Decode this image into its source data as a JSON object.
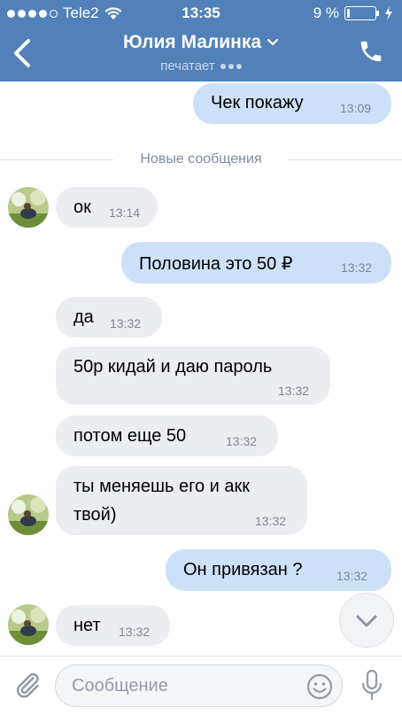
{
  "status_bar": {
    "carrier": "Tele2",
    "time": "13:35",
    "battery": "9 %",
    "battery_level": 0.09
  },
  "header": {
    "title": "Юлия Малинка",
    "subtitle": "печатает"
  },
  "divider_label": "Новые сообщения",
  "messages": [
    {
      "text": "Чек покажу",
      "time": "13:09"
    },
    {
      "text": "ок",
      "time": "13:14"
    },
    {
      "text": "Половина это 50 ₽",
      "time": "13:32"
    },
    {
      "text": "да",
      "time": "13:32"
    },
    {
      "text": "50р кидай и даю пароль",
      "time": "13:32"
    },
    {
      "text": "потом еще 50",
      "time": "13:32"
    },
    {
      "line1": "ты меняешь его и акк",
      "line2": "твой)",
      "time": "13:32"
    },
    {
      "text": "Он привязан ?",
      "time": "13:32"
    },
    {
      "text": "нет",
      "time": "13:32"
    }
  ],
  "composer": {
    "placeholder": "Сообщение"
  },
  "colors": {
    "header": "#5181b8",
    "incoming": "#ebedf0",
    "outgoing": "#cce1f8"
  }
}
